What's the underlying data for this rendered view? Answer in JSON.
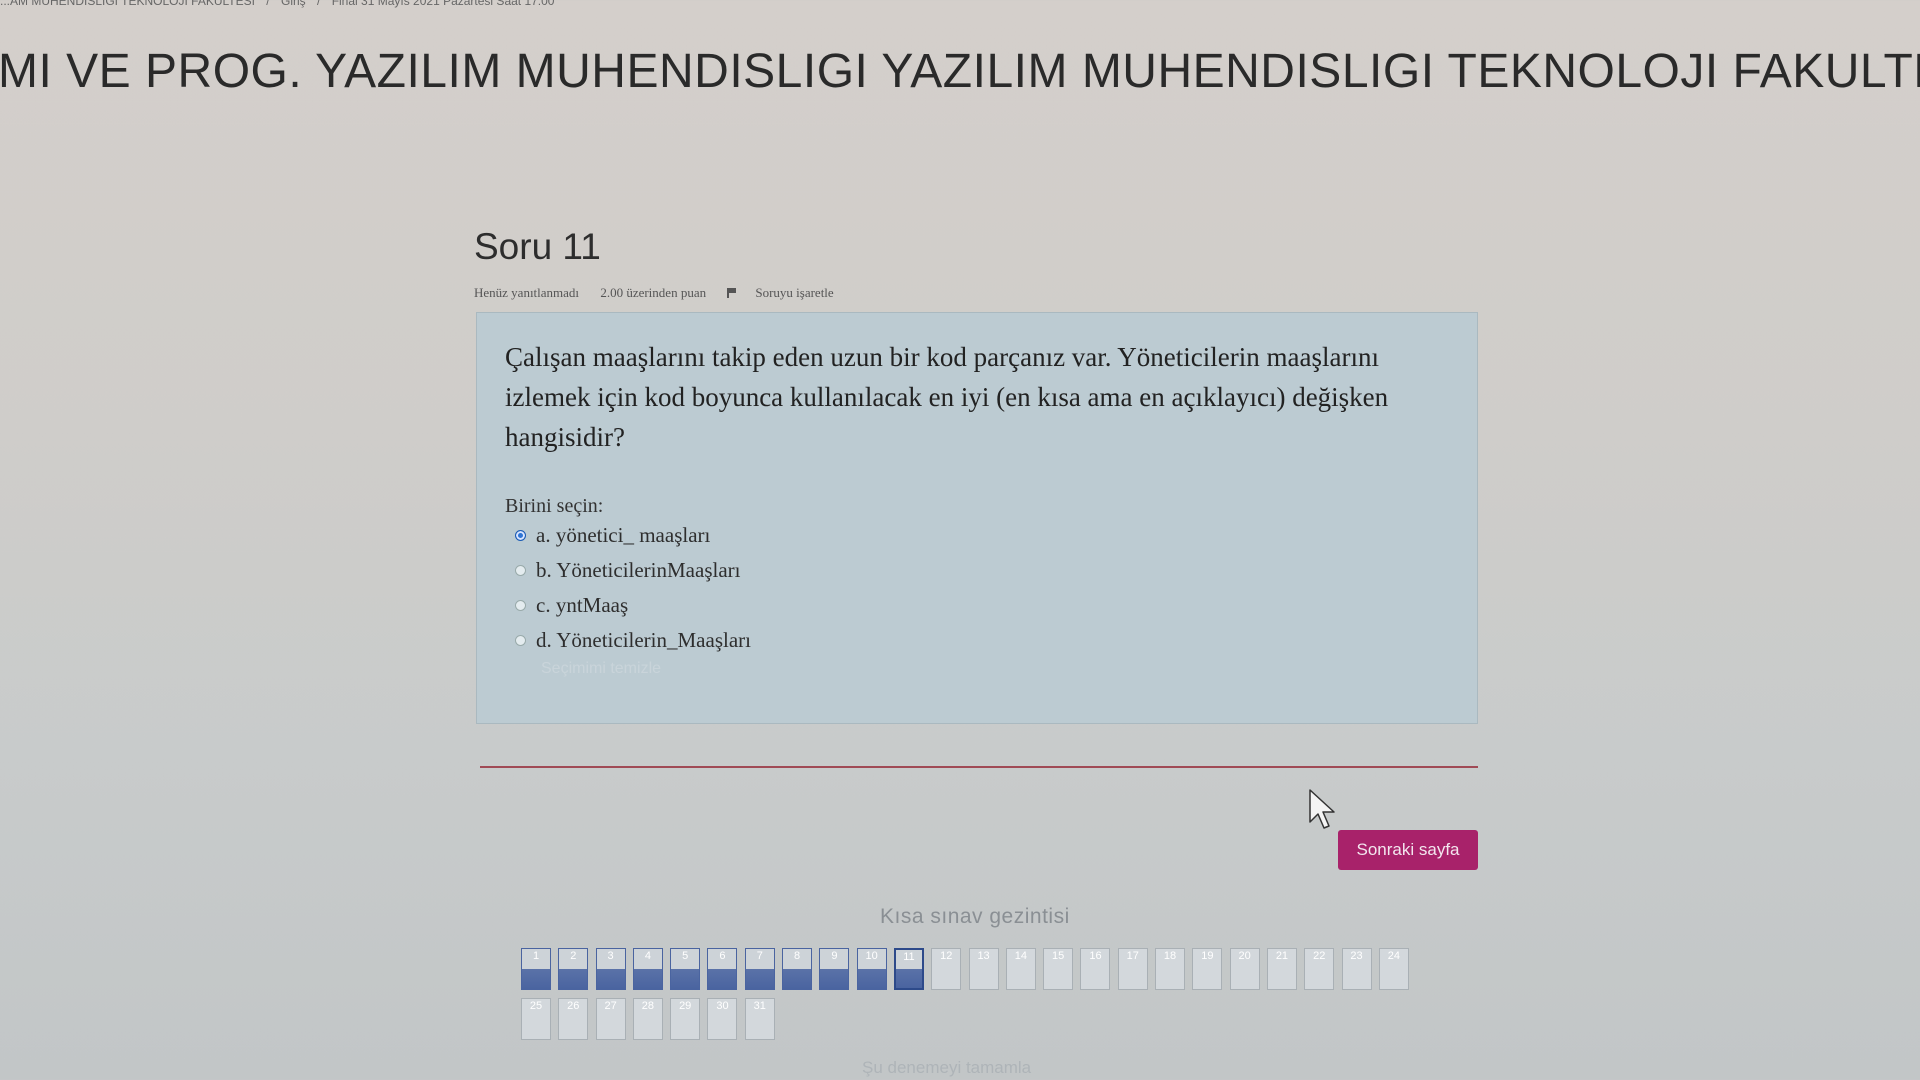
{
  "breadcrumb": [
    "...AM MUHENDISLIGI TEKNOLOJI FAKULTESI",
    "Giriş",
    "Final 31 Mayıs 2021 Pazartesi Saat 17:00"
  ],
  "course_title": "MI VE PROG. YAZILIM MUHENDISLIGI YAZILIM MUHENDISLIGI TEKNOLOJI FAKULTESI",
  "question": {
    "heading": "Soru 11",
    "status": "Henüz yanıtlanmadı",
    "points": "2.00 üzerinden puan",
    "flag_label": "Soruyu işaretle",
    "text": "Çalışan maaşlarını takip eden uzun bir kod parçanız var. Yöneticilerin maaşlarını izlemek için kod boyunca kullanılacak en iyi (en kısa ama en açıklayıcı) değişken hangisidir?",
    "select_label": "Birini seçin:",
    "options": [
      {
        "label": "a. yönetici_ maaşları",
        "selected": true
      },
      {
        "label": "b. YöneticilerinMaaşları",
        "selected": false
      },
      {
        "label": "c. yntMaaş",
        "selected": false
      },
      {
        "label": "d. Yöneticilerin_Maaşları",
        "selected": false
      }
    ],
    "clear_label": "Seçimimi temizle"
  },
  "next_button": "Sonraki sayfa",
  "navigation": {
    "title": "Kısa sınav gezintisi",
    "row1": [
      "1",
      "2",
      "3",
      "4",
      "5",
      "6",
      "7",
      "8",
      "9",
      "10",
      "11",
      "12",
      "13",
      "14",
      "15",
      "16",
      "17",
      "18",
      "19",
      "20",
      "21",
      "22",
      "23",
      "24"
    ],
    "row2": [
      "25",
      "26",
      "27",
      "28",
      "29",
      "30",
      "31"
    ],
    "answered": [
      "1",
      "2",
      "3",
      "4",
      "5",
      "6",
      "7",
      "8",
      "9",
      "10"
    ],
    "current": "11",
    "finish_label": "Şu denemeyi tamamla"
  },
  "colors": {
    "accent": "#a8226a",
    "answered": "#4a64a0",
    "question_bg": "#bccbd2"
  }
}
